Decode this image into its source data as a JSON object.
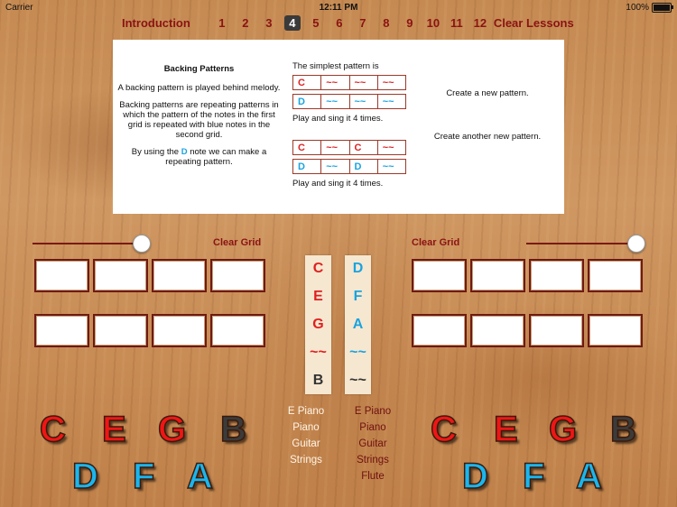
{
  "status_bar": {
    "carrier": "Carrier",
    "time": "12:11 PM",
    "battery": "100%"
  },
  "nav": {
    "intro": "Introduction",
    "lessons": [
      "1",
      "2",
      "3",
      "4",
      "5",
      "6",
      "7",
      "8",
      "9",
      "10",
      "11",
      "12"
    ],
    "active_lesson": "4",
    "clear": "Clear Lessons"
  },
  "panel": {
    "title": "Backing Patterns",
    "p1": "A backing pattern is played behind melody.",
    "p2": "Backing patterns are repeating patterns in which the pattern of the notes in the first grid is repeated with blue notes in the second grid.",
    "p3_a": "By using the ",
    "p3_note": "D",
    "p3_b": " note we can make a repeating pattern.",
    "simplest": "The simplest pattern is",
    "grid1": [
      "C",
      "~~",
      "~~",
      "~~"
    ],
    "grid2": [
      "D",
      "~~",
      "~~",
      "~~"
    ],
    "play1": "Play and sing it 4 times.",
    "grid3": [
      "C",
      "~~",
      "C",
      "~~"
    ],
    "grid4": [
      "D",
      "~~",
      "D",
      "~~"
    ],
    "play2": "Play and sing it 4 times.",
    "create1": "Create a new pattern.",
    "create2": "Create another new pattern."
  },
  "controls": {
    "clear_grid_left": "Clear Grid",
    "clear_grid_right": "Clear Grid"
  },
  "strip_left": [
    "C",
    "E",
    "G",
    "~~",
    "B"
  ],
  "strip_right": [
    "D",
    "F",
    "A",
    "~~",
    "~~"
  ],
  "instruments_left": [
    "E Piano",
    "Piano",
    "Guitar",
    "Strings"
  ],
  "instruments_right": [
    "E Piano",
    "Piano",
    "Guitar",
    "Strings",
    "Flute"
  ],
  "big_notes": {
    "left_top": [
      "C",
      "E",
      "G",
      "B"
    ],
    "left_bottom": [
      "D",
      "F",
      "A"
    ],
    "right_top": [
      "C",
      "E",
      "G",
      "B"
    ],
    "right_bottom": [
      "D",
      "F",
      "A"
    ]
  },
  "colors": {
    "red_note": "#f01515",
    "blue_note": "#1ab6ee",
    "dark_note": "#3b3b3b",
    "nav_text": "#8b1313"
  }
}
